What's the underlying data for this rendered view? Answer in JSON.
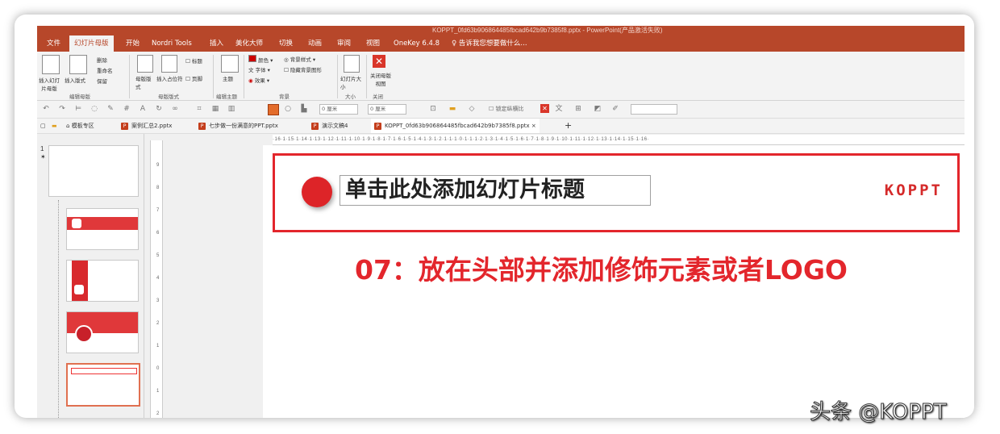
{
  "window": {
    "title": "KOPPT_0fd63b906864485fbcad642b9b7385f8.pptx - PowerPoint(产品激活失败)"
  },
  "ribbon_tabs": [
    {
      "label": "文件",
      "active": false
    },
    {
      "label": "幻灯片母版",
      "active": true
    },
    {
      "label": "开始",
      "active": false
    },
    {
      "label": "Nordri Tools",
      "active": false
    },
    {
      "label": "插入",
      "active": false
    },
    {
      "label": "美化大师",
      "active": false
    },
    {
      "label": "切换",
      "active": false
    },
    {
      "label": "动画",
      "active": false
    },
    {
      "label": "审阅",
      "active": false
    },
    {
      "label": "视图",
      "active": false
    },
    {
      "label": "OneKey 6.4.8",
      "active": false
    },
    {
      "label": "♀ 告诉我您想要做什么...",
      "active": false
    }
  ],
  "ribbon": {
    "insert_master": "插入幻灯片母版",
    "insert_layout": "插入版式",
    "delete": "删除",
    "rename": "重命名",
    "preserve": "保留",
    "group_edit_master": "编辑母版",
    "master_layout": "母版版式",
    "insert_placeholder": "插入占位符",
    "title_chk": "标题",
    "footer_chk": "页脚",
    "group_master_layout": "母版版式",
    "theme": "主题",
    "group_edit_theme": "编辑主题",
    "colors": "颜色",
    "fonts": "字体",
    "effects": "效果",
    "bg_styles": "背景样式",
    "hide_bg": "隐藏背景图形",
    "group_background": "背景",
    "slide_size": "幻灯片大小",
    "group_size": "大小",
    "close_master": "关闭母版视图",
    "group_close": "关闭"
  },
  "quick_access": {
    "width_value": "0 厘米",
    "height_value": "0 厘米",
    "lock_ratio": "锁定纵横比"
  },
  "doc_tabs": [
    {
      "label": "模板专区",
      "type": "home"
    },
    {
      "label": "案例汇总2.pptx",
      "type": "ppt"
    },
    {
      "label": "七步做一份满意的PPT.pptx",
      "type": "ppt"
    },
    {
      "label": "演示文稿4",
      "type": "ppt"
    },
    {
      "label": "KOPPT_0fd63b906864485fbcad642b9b7385f8.pptx",
      "type": "ppt",
      "active": true
    }
  ],
  "new_tab": "+",
  "close_tab": "×",
  "slide_number": "1",
  "hruler_text": "·16·1·15·1·14·1·13·1·12·1·11·1·10·1·9·1·8·1·7·1·6·1·5·1·4·1·3·1·2·1·1·1·0·1·1·1·2·1·3·1·4·1·5·1·6·1·7·1·8·1·9·1·10·1·11·1·12·1·13·1·14·1·15·1·16·",
  "vruler_ticks": [
    "9",
    "8",
    "7",
    "6",
    "5",
    "4",
    "3",
    "2",
    "1",
    "0",
    "1",
    "2"
  ],
  "slide": {
    "title_placeholder": "单击此处添加幻灯片标题",
    "logo_text": "KOPPT",
    "caption": "07：放在头部并添加修饰元素或者LOGO",
    "accent_color": "#e3262c"
  },
  "watermark": "头条 @KOPPT"
}
